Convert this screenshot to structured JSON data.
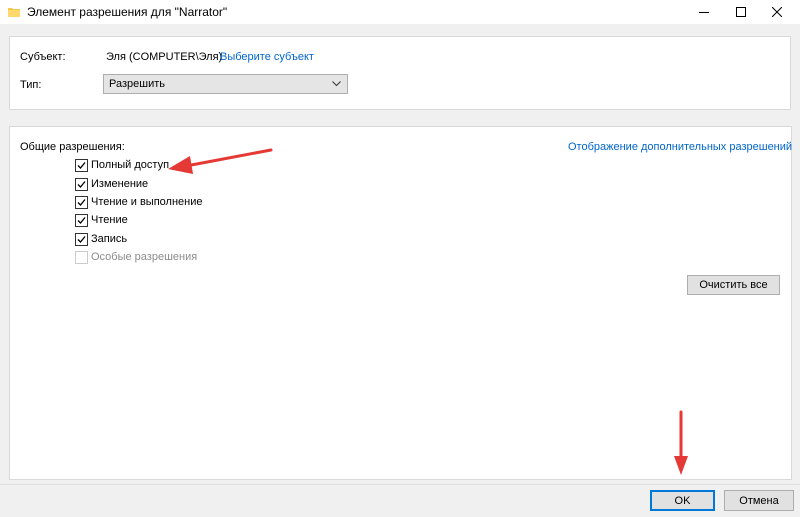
{
  "window": {
    "title": "Элемент разрешения для \"Narrator\"",
    "controls": [
      "minimize",
      "maximize",
      "close"
    ]
  },
  "principal": {
    "label": "Субъект:",
    "value": "Эля (COMPUTER\\Эля)",
    "select_link": "Выберите субъект"
  },
  "type": {
    "label": "Тип:",
    "selected": "Разрешить"
  },
  "permissions": {
    "heading": "Общие разрешения:",
    "advanced_link": "Отображение дополнительных разрешений",
    "items": [
      {
        "label": "Полный доступ",
        "checked": true,
        "enabled": true
      },
      {
        "label": "Изменение",
        "checked": true,
        "enabled": true
      },
      {
        "label": "Чтение и выполнение",
        "checked": true,
        "enabled": true
      },
      {
        "label": "Чтение",
        "checked": true,
        "enabled": true
      },
      {
        "label": "Запись",
        "checked": true,
        "enabled": true
      },
      {
        "label": "Особые разрешения",
        "checked": false,
        "enabled": false
      }
    ],
    "clear_all": "Очистить все"
  },
  "footer": {
    "ok": "OK",
    "cancel": "Отмена"
  },
  "annotation_color": "#e53935"
}
